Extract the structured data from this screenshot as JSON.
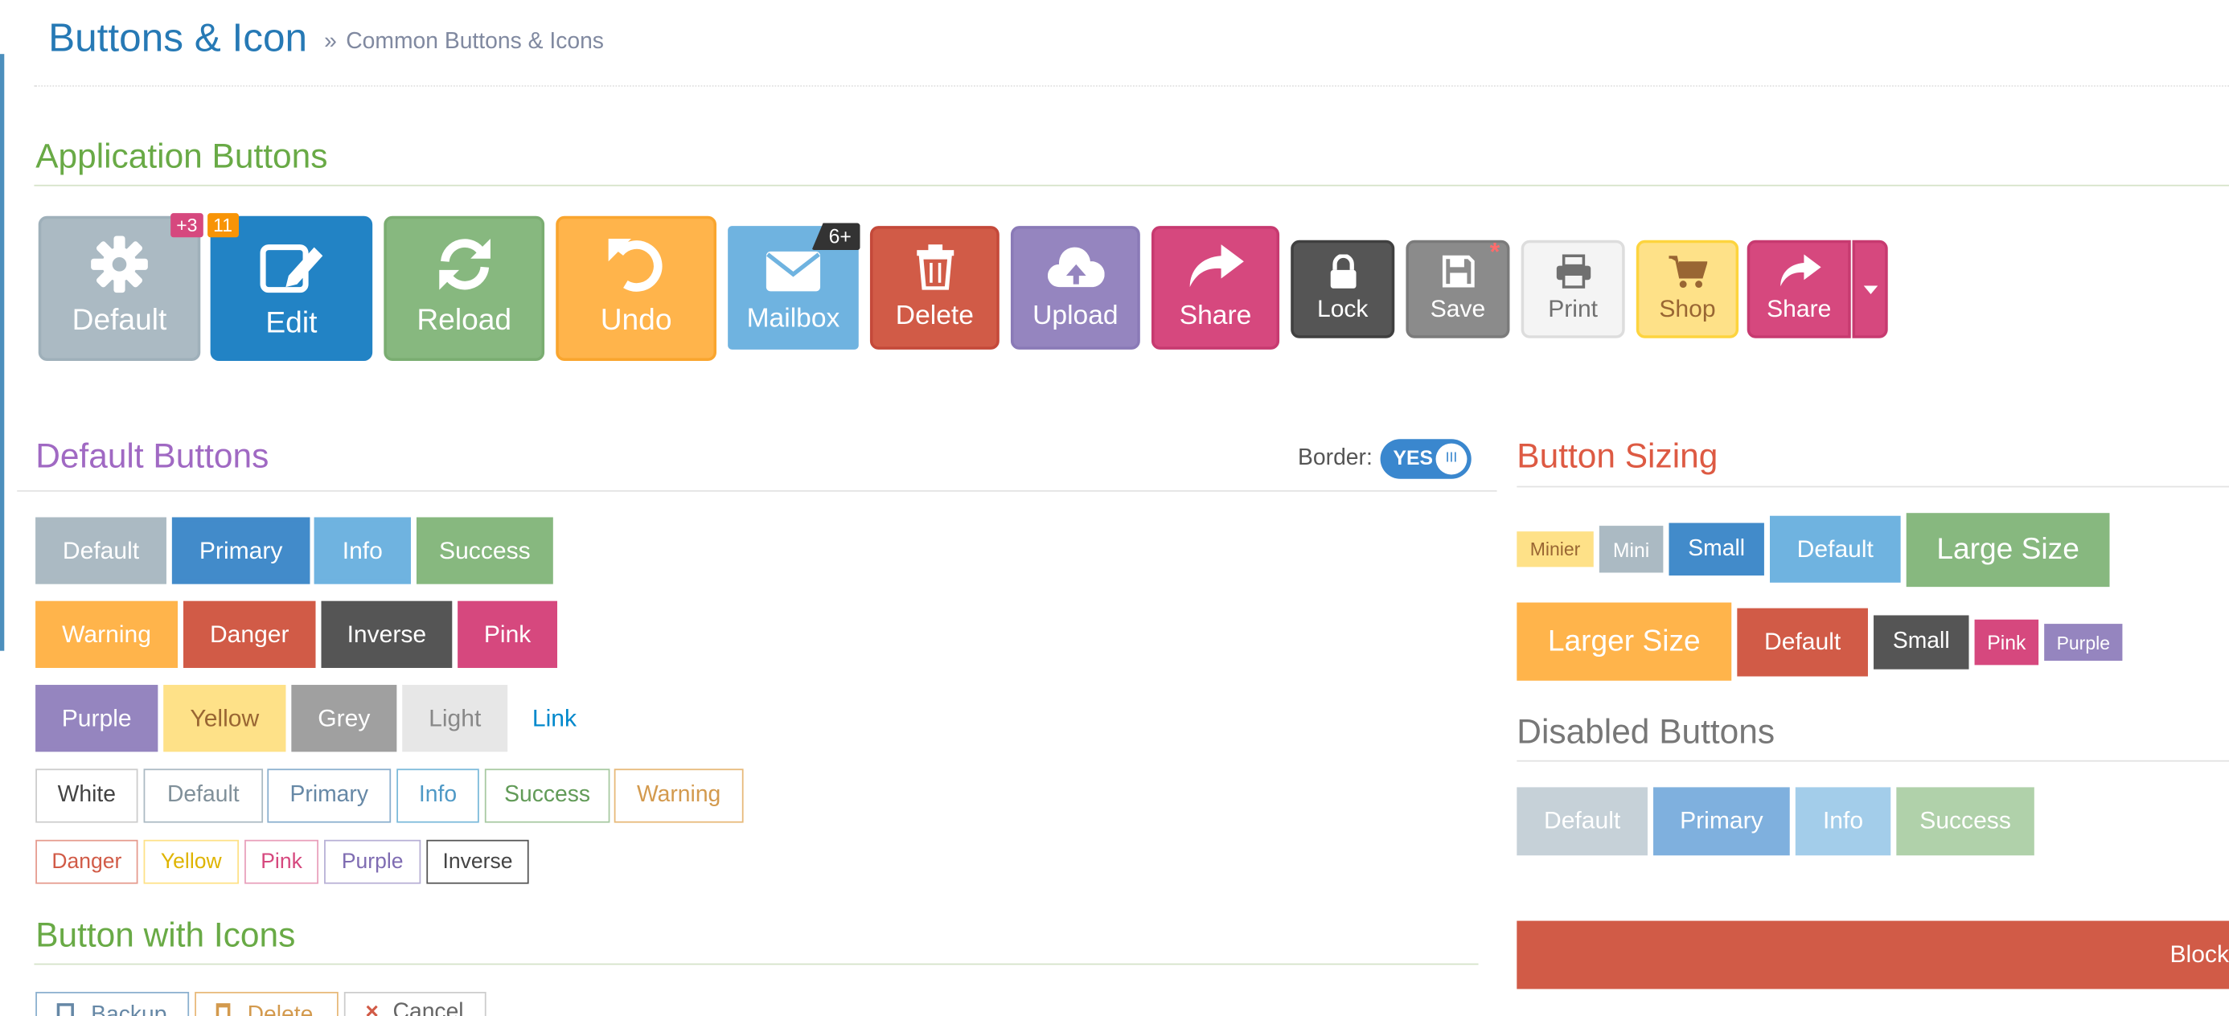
{
  "header": {
    "title": "Buttons & Icon",
    "breadcrumb_sep": "»",
    "breadcrumb": "Common Buttons & Icons"
  },
  "sections": {
    "app_buttons": "Application Buttons",
    "default_buttons": "Default Buttons",
    "button_sizing": "Button Sizing",
    "disabled_buttons": "Disabled Buttons",
    "button_with_icons": "Button with Icons"
  },
  "border_toggle": {
    "label": "Border:",
    "state": "YES",
    "knob": "III"
  },
  "app_buttons": [
    {
      "label": "Default",
      "icon": "gear-icon",
      "badge": "+3",
      "color": "#abbac3"
    },
    {
      "label": "Edit",
      "icon": "edit-icon",
      "badge": "11",
      "color": "#2283c5"
    },
    {
      "label": "Reload",
      "icon": "refresh-icon",
      "color": "#87b87f"
    },
    {
      "label": "Undo",
      "icon": "undo-icon",
      "color": "#ffb44b"
    },
    {
      "label": "Mailbox",
      "icon": "envelope-icon",
      "badge": "6+",
      "color": "#6fb3e0"
    },
    {
      "label": "Delete",
      "icon": "trash-icon",
      "color": "#d15b47"
    },
    {
      "label": "Upload",
      "icon": "cloud-upload-icon",
      "color": "#9585bf"
    },
    {
      "label": "Share",
      "icon": "share-icon",
      "color": "#d6487e"
    },
    {
      "label": "Lock",
      "icon": "lock-icon",
      "color": "#555555"
    },
    {
      "label": "Save",
      "icon": "floppy-icon",
      "badge": "*",
      "color": "#8b8b8b"
    },
    {
      "label": "Print",
      "icon": "print-icon",
      "color": "#f4f4f4"
    },
    {
      "label": "Shop",
      "icon": "cart-icon",
      "color": "#fee188"
    },
    {
      "label": "Share",
      "icon": "share-icon",
      "color": "#d6487e"
    }
  ],
  "default_buttons": {
    "row1": [
      "Default",
      "Primary",
      "Info",
      "Success"
    ],
    "row2": [
      "Warning",
      "Danger",
      "Inverse",
      "Pink"
    ],
    "row3": [
      "Purple",
      "Yellow",
      "Grey",
      "Light",
      "Link"
    ],
    "outline_row1": [
      "White",
      "Default",
      "Primary",
      "Info",
      "Success",
      "Warning"
    ],
    "outline_row2": [
      "Danger",
      "Yellow",
      "Pink",
      "Purple",
      "Inverse"
    ]
  },
  "sizing": {
    "row1": [
      "Minier",
      "Mini",
      "Small",
      "Default",
      "Large Size"
    ],
    "row2": [
      "Larger Size",
      "Default",
      "Small",
      "Pink",
      "Purple"
    ]
  },
  "disabled": [
    "Default",
    "Primary",
    "Info",
    "Success"
  ],
  "block_button": "Block",
  "icon_buttons": [
    "Backup",
    "Delete",
    "Cancel"
  ]
}
